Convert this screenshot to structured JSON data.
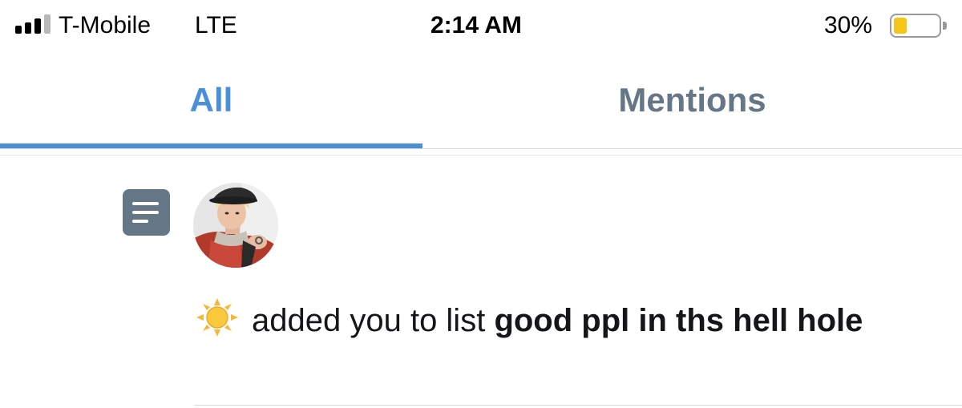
{
  "status_bar": {
    "carrier": "T-Mobile",
    "network": "LTE",
    "time": "2:14 AM",
    "battery_percent": "30%",
    "battery_level": 0.3,
    "signal_bars": 3,
    "signal_total": 4
  },
  "tabs": [
    {
      "label": "All",
      "active": true
    },
    {
      "label": "Mentions",
      "active": false
    }
  ],
  "notification": {
    "user_display_name_icon": "sun-emoji",
    "action_text": "added you to list",
    "list_name": "good ppl in ths hell hole",
    "type_icon": "list-icon"
  },
  "colors": {
    "accent": "#4a90d9",
    "inactive_tab": "#657786",
    "battery_fill": "#f5c518",
    "text": "#14171a"
  }
}
